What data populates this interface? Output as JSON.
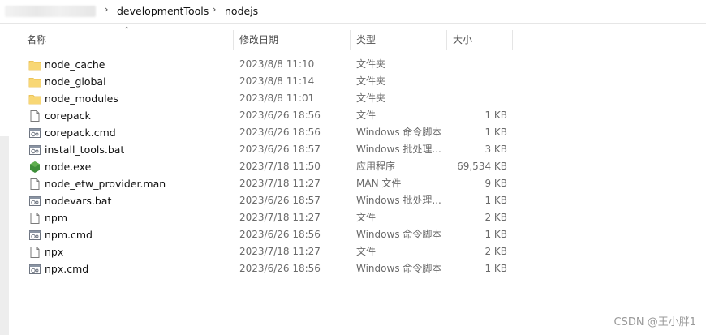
{
  "breadcrumb": {
    "items": [
      "developmentTools",
      "nodejs"
    ],
    "separator": "›"
  },
  "columns": {
    "name": "名称",
    "date": "修改日期",
    "type": "类型",
    "size": "大小"
  },
  "files": [
    {
      "name": "node_cache",
      "date": "2023/8/8 11:10",
      "type": "文件夹",
      "size": "",
      "icon": "folder-icon"
    },
    {
      "name": "node_global",
      "date": "2023/8/8 11:14",
      "type": "文件夹",
      "size": "",
      "icon": "folder-icon"
    },
    {
      "name": "node_modules",
      "date": "2023/8/8 11:01",
      "type": "文件夹",
      "size": "",
      "icon": "folder-icon"
    },
    {
      "name": "corepack",
      "date": "2023/6/26 18:56",
      "type": "文件",
      "size": "1 KB",
      "icon": "file-icon"
    },
    {
      "name": "corepack.cmd",
      "date": "2023/6/26 18:56",
      "type": "Windows 命令脚本",
      "size": "1 KB",
      "icon": "script-icon"
    },
    {
      "name": "install_tools.bat",
      "date": "2023/6/26 18:57",
      "type": "Windows 批处理...",
      "size": "3 KB",
      "icon": "script-icon"
    },
    {
      "name": "node.exe",
      "date": "2023/7/18 11:50",
      "type": "应用程序",
      "size": "69,534 KB",
      "icon": "node-exe-icon"
    },
    {
      "name": "node_etw_provider.man",
      "date": "2023/7/18 11:27",
      "type": "MAN 文件",
      "size": "9 KB",
      "icon": "file-icon"
    },
    {
      "name": "nodevars.bat",
      "date": "2023/6/26 18:57",
      "type": "Windows 批处理...",
      "size": "1 KB",
      "icon": "script-icon"
    },
    {
      "name": "npm",
      "date": "2023/7/18 11:27",
      "type": "文件",
      "size": "2 KB",
      "icon": "file-icon"
    },
    {
      "name": "npm.cmd",
      "date": "2023/6/26 18:56",
      "type": "Windows 命令脚本",
      "size": "1 KB",
      "icon": "script-icon"
    },
    {
      "name": "npx",
      "date": "2023/7/18 11:27",
      "type": "文件",
      "size": "2 KB",
      "icon": "file-icon"
    },
    {
      "name": "npx.cmd",
      "date": "2023/6/26 18:56",
      "type": "Windows 命令脚本",
      "size": "1 KB",
      "icon": "script-icon"
    }
  ],
  "watermark": "CSDN @王小胖1",
  "colors": {
    "folder": "#f8d775",
    "folder_dark": "#e6b83f",
    "node_green": "#3f8f3a",
    "header_text": "#4d4d4d",
    "meta_text": "#6a6a6a"
  }
}
